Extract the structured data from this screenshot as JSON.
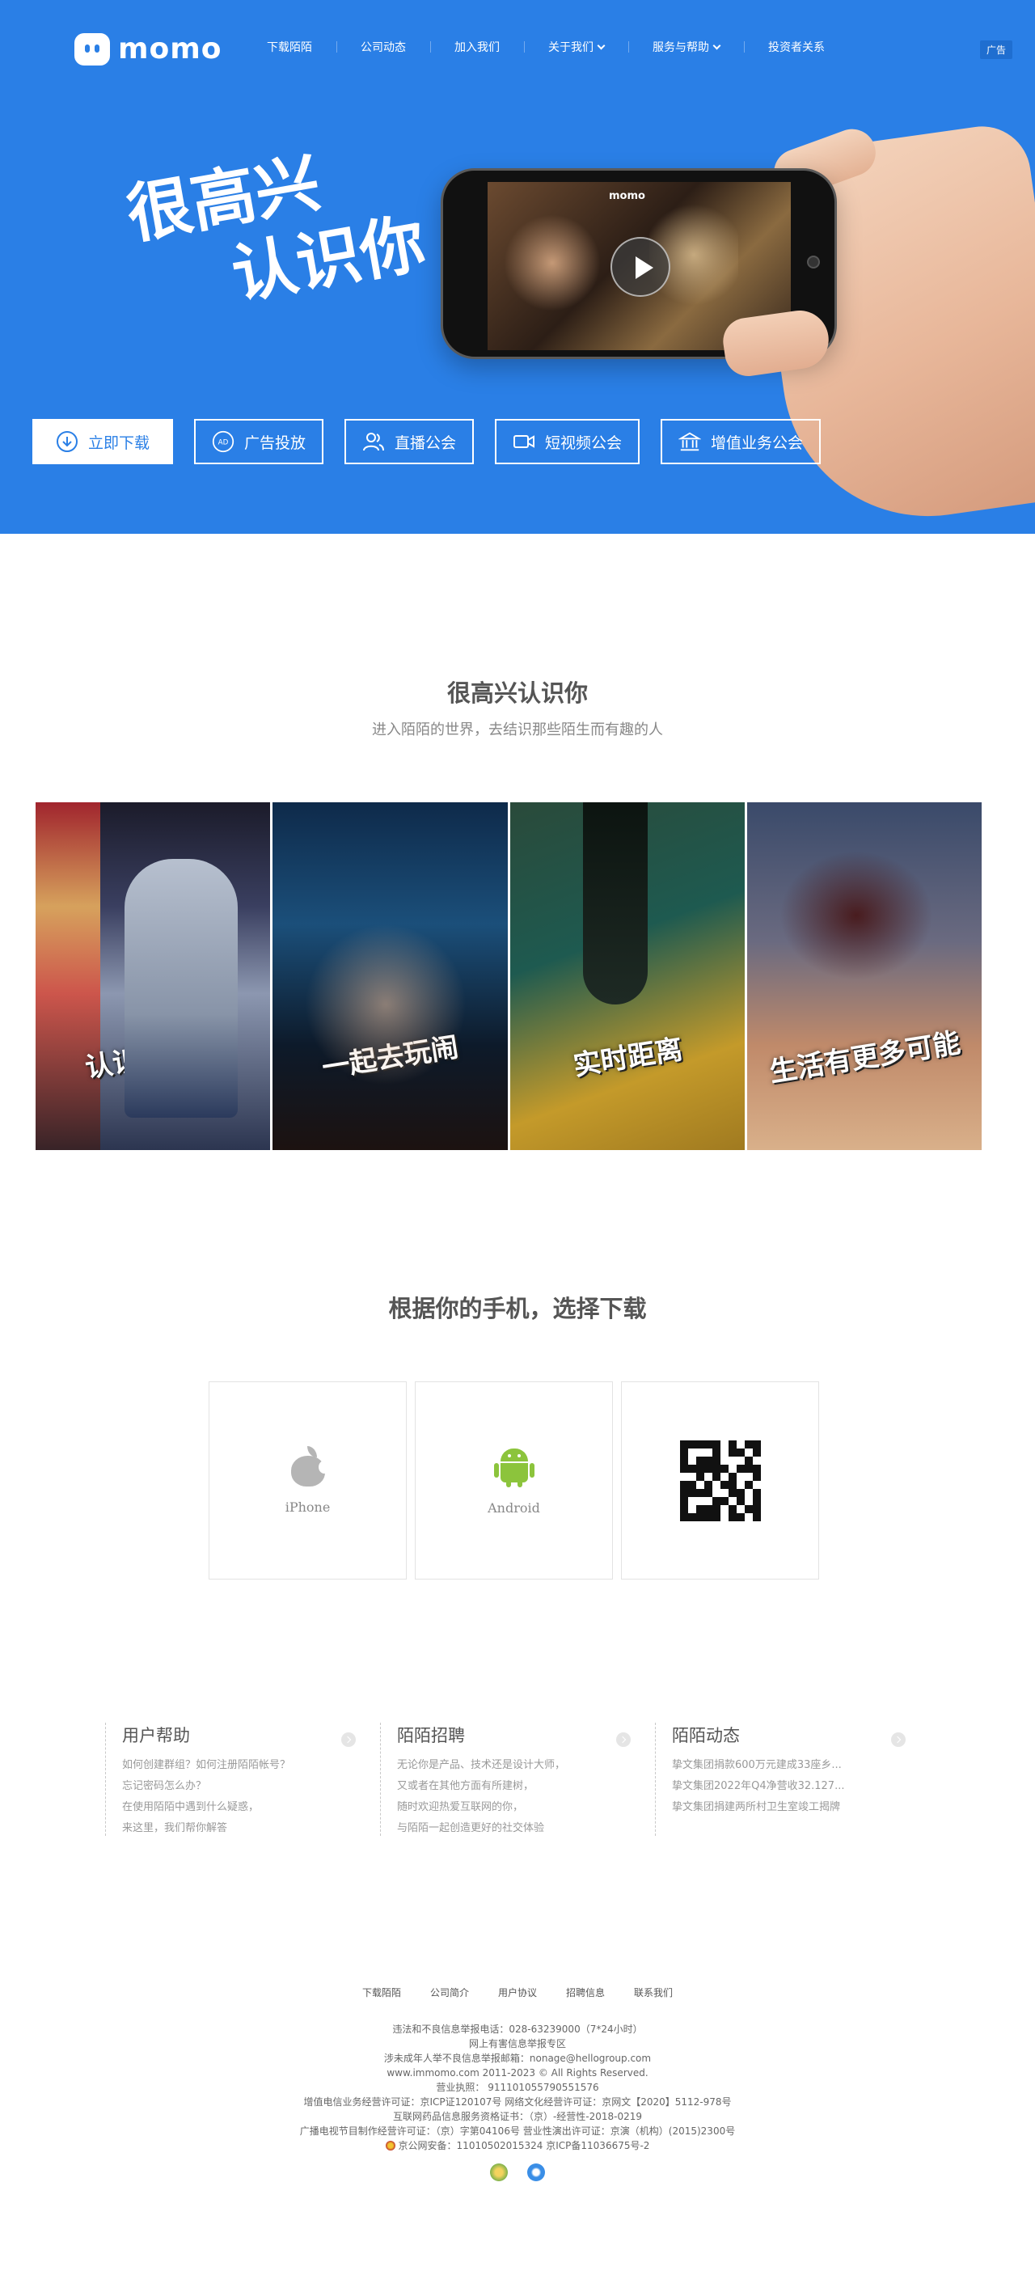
{
  "header": {
    "logo_text": "momo",
    "nav": [
      {
        "label": "下载陌陌",
        "dropdown": false
      },
      {
        "label": "公司动态",
        "dropdown": false
      },
      {
        "label": "加入我们",
        "dropdown": false
      },
      {
        "label": "关于我们",
        "dropdown": true
      },
      {
        "label": "服务与帮助",
        "dropdown": true
      },
      {
        "label": "投资者关系",
        "dropdown": false
      }
    ],
    "ad_tag": "广告"
  },
  "hero": {
    "slogan_line1": "很高兴",
    "slogan_line2": "认识你",
    "phone_brand": "momo",
    "buttons": [
      {
        "label": "立即下载",
        "icon": "download-icon"
      },
      {
        "label": "广告投放",
        "icon": "ad-icon"
      },
      {
        "label": "直播公会",
        "icon": "users-icon"
      },
      {
        "label": "短视频公会",
        "icon": "video-camera-icon"
      },
      {
        "label": "增值业务公会",
        "icon": "bank-icon"
      }
    ],
    "colors": {
      "background": "#2a7fe6"
    }
  },
  "intro": {
    "title": "很高兴认识你",
    "subtitle": "进入陌陌的世界，去结识那些陌生而有趣的人",
    "tiles": [
      {
        "caption": "认识新朋友"
      },
      {
        "caption": "一起去玩闹"
      },
      {
        "caption": "实时距离"
      },
      {
        "caption": "生活有更多可能"
      }
    ]
  },
  "download": {
    "title": "根据你的手机，选择下载",
    "cards": [
      {
        "label": "iPhone",
        "icon": "apple-icon"
      },
      {
        "label": "Android",
        "icon": "android-icon"
      },
      {
        "label": "",
        "icon": "qr-code-icon"
      }
    ]
  },
  "info": [
    {
      "title": "用户帮助",
      "lines": [
        "如何创建群组？如何注册陌陌帐号？",
        "忘记密码怎么办？",
        "在使用陌陌中遇到什么疑惑，",
        "来这里，我们帮你解答"
      ]
    },
    {
      "title": "陌陌招聘",
      "lines": [
        "无论你是产品、技术还是设计大师，",
        "又或者在其他方面有所建树，",
        "随时欢迎热爱互联网的你，",
        "与陌陌一起创造更好的社交体验"
      ]
    },
    {
      "title": "陌陌动态",
      "lines": [
        "挚文集团捐款600万元建成33座乡...",
        "挚文集团2022年Q4净营收32.127...",
        "挚文集团捐建两所村卫生室竣工揭牌"
      ]
    }
  ],
  "footer": {
    "links": [
      "下载陌陌",
      "公司简介",
      "用户协议",
      "招聘信息",
      "联系我们"
    ],
    "legal": [
      "违法和不良信息举报电话：028-63239000（7*24小时）",
      "网上有害信息举报专区",
      "涉未成年人举不良信息举报邮箱：nonage@hellogroup.com",
      "www.immomo.com 2011-2023 © All Rights Reserved.",
      "营业执照： 911101055790551576",
      "增值电信业务经营许可证：京ICP证120107号   网络文化经营许可证：京网文【2020】5112-978号",
      "互联网药品信息服务资格证书：（京）-经营性-2018-0219",
      "广播电视节目制作经营许可证：（京）字第04106号   营业性演出许可证：京演（机构）(2015)2300号"
    ],
    "police": "京公网安备：11010502015324   京ICP备11036675号-2"
  }
}
